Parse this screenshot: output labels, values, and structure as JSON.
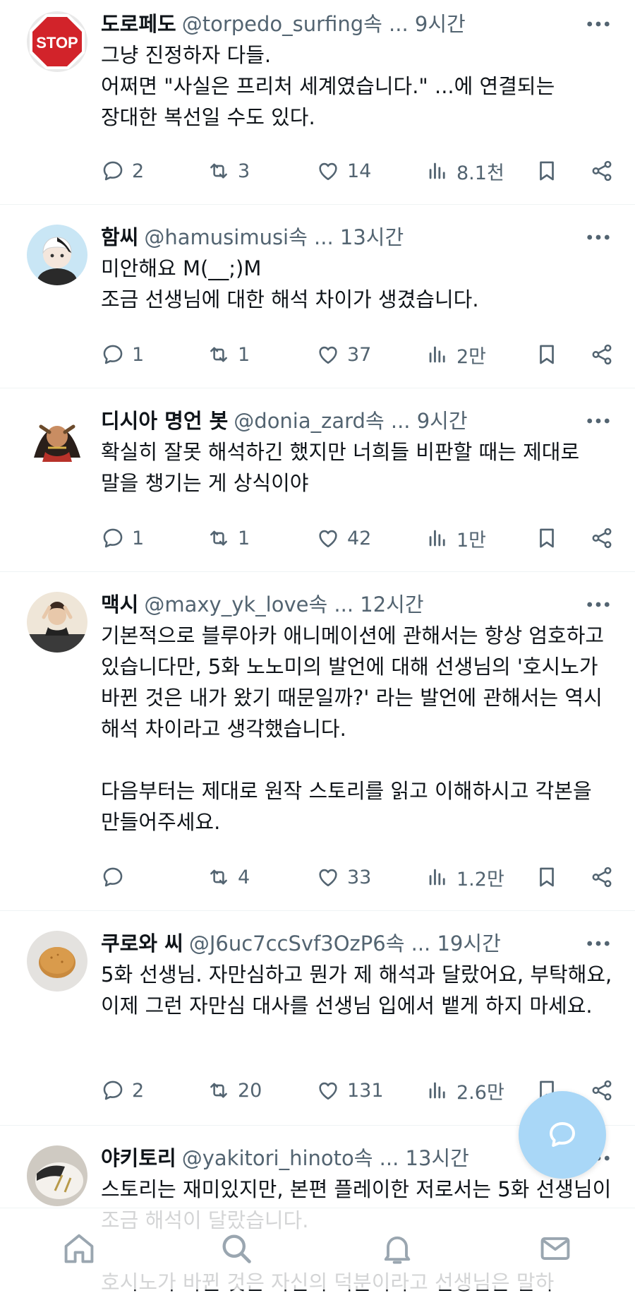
{
  "colors": {
    "text_primary": "#0f1419",
    "text_secondary": "#536471",
    "divider": "#eff3f4",
    "fab": "#a9d7f7"
  },
  "posts": [
    {
      "avatar_icon": "stop-sign-avatar",
      "name": "도로페도",
      "handle": "@torpedo_surfing속 ... 9시간",
      "text": "그냥 진정하자 다들.\n어쩌면 \"사실은 프리처 세계였습니다.\" ...에 연결되는 장대한 복선일 수도 있다.",
      "replies": "2",
      "reposts": "3",
      "likes": "14",
      "views": "8.1천"
    },
    {
      "avatar_icon": "anime-character-avatar",
      "name": "함씨",
      "handle": "@hamusimusi속 ... 13시간",
      "text": "미안해요 M(__;)M\n조금 선생님에 대한 해석 차이가 생겼습니다.",
      "replies": "1",
      "reposts": "1",
      "likes": "37",
      "views": "2만"
    },
    {
      "avatar_icon": "anime-warrior-avatar",
      "name": "디시아 명언 봇",
      "handle": "@donia_zard속 ... 9시간",
      "text": "확실히 잘못 해석하긴 했지만 너희들 비판할 때는 제대로 말을 챙기는 게 상식이야",
      "replies": "1",
      "reposts": "1",
      "likes": "42",
      "views": "1만"
    },
    {
      "avatar_icon": "person-photo-avatar",
      "name": "맥시",
      "handle": "@maxy_yk_love속 ... 12시간",
      "text": "기본적으로 블루아카 애니메이션에 관해서는 항상 엄호하고 있습니다만, 5화 노노미의 발언에 대해 선생님의 '호시노가 바뀐 것은 내가 왔기 때문일까?' 라는 발언에 관해서는 역시 해석 차이라고 생각했습니다.\n\n다음부터는 제대로 원작 스토리를 읽고 이해하시고 각본을 만들어주세요.",
      "replies": "",
      "reposts": "4",
      "likes": "33",
      "views": "1.2만"
    },
    {
      "avatar_icon": "cookie-avatar",
      "name": "쿠로와 씨",
      "handle": "@J6uc7ccSvf3OzP6속 ... 19시간",
      "text": "5화 선생님. 자만심하고 뭔가 제 해석과 달랐어요, 부탁해요, 이제 그런 자만심 대사를 선생님 입에서 뱉게 하지 마세요.",
      "replies": "2",
      "reposts": "20",
      "likes": "131",
      "views": "2.6만"
    },
    {
      "avatar_icon": "cat-photo-avatar",
      "name": "야키토리",
      "handle": "@yakitori_hinoto속 ... 13시간",
      "text": "스토리는 재미있지만, 본편 플레이한 저로서는 5화 선생님이 조금 해석이 달랐습니다.\n\n호시노가 바뀐 것은 자신의 덕분이라고 선생님은 말하",
      "replies": "",
      "reposts": "",
      "likes": "",
      "views": ""
    }
  ],
  "fab": {
    "icon": "compose-reply-icon"
  },
  "bottom_nav": [
    {
      "icon": "home-icon"
    },
    {
      "icon": "search-icon"
    },
    {
      "icon": "bell-icon"
    },
    {
      "icon": "mail-icon"
    }
  ]
}
